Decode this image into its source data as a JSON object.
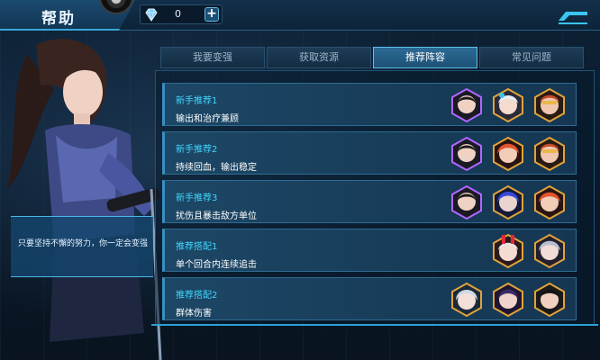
{
  "header": {
    "title": "帮助",
    "currency_value": "0",
    "plus_label": "+"
  },
  "tabs": [
    {
      "label": "我要变强",
      "active": false
    },
    {
      "label": "获取资源",
      "active": false
    },
    {
      "label": "推荐阵容",
      "active": true
    },
    {
      "label": "常见问题",
      "active": false
    }
  ],
  "speech": {
    "text": "只要坚持不懈的努力，你一定会变强"
  },
  "recommendations": [
    {
      "title": "新手推荐1",
      "desc": "输出和治疗兼顾",
      "heroes": [
        "hero-dark-hair",
        "hero-white-hair",
        "hero-gold-mask"
      ]
    },
    {
      "title": "新手推荐2",
      "desc": "持续回血，输出稳定",
      "heroes": [
        "hero-dark-hair",
        "hero-red-hair",
        "hero-gold-mask"
      ]
    },
    {
      "title": "新手推荐3",
      "desc": "扰伤且暴击敌方单位",
      "heroes": [
        "hero-dark-hair",
        "hero-blue-hair",
        "hero-red-hair"
      ]
    },
    {
      "title": "推荐搭配1",
      "desc": "单个回合内连续追击",
      "heroes": [
        "hero-pink-bunny",
        "hero-silver-hair"
      ]
    },
    {
      "title": "推荐搭配2",
      "desc": "群体伤害",
      "heroes": [
        "hero-blue-hood",
        "hero-purple-hair",
        "hero-black-hair"
      ]
    }
  ],
  "colors": {
    "accent": "#42d6ff",
    "border_gold": "#e0a33a",
    "border_purple": "#b266ff"
  }
}
